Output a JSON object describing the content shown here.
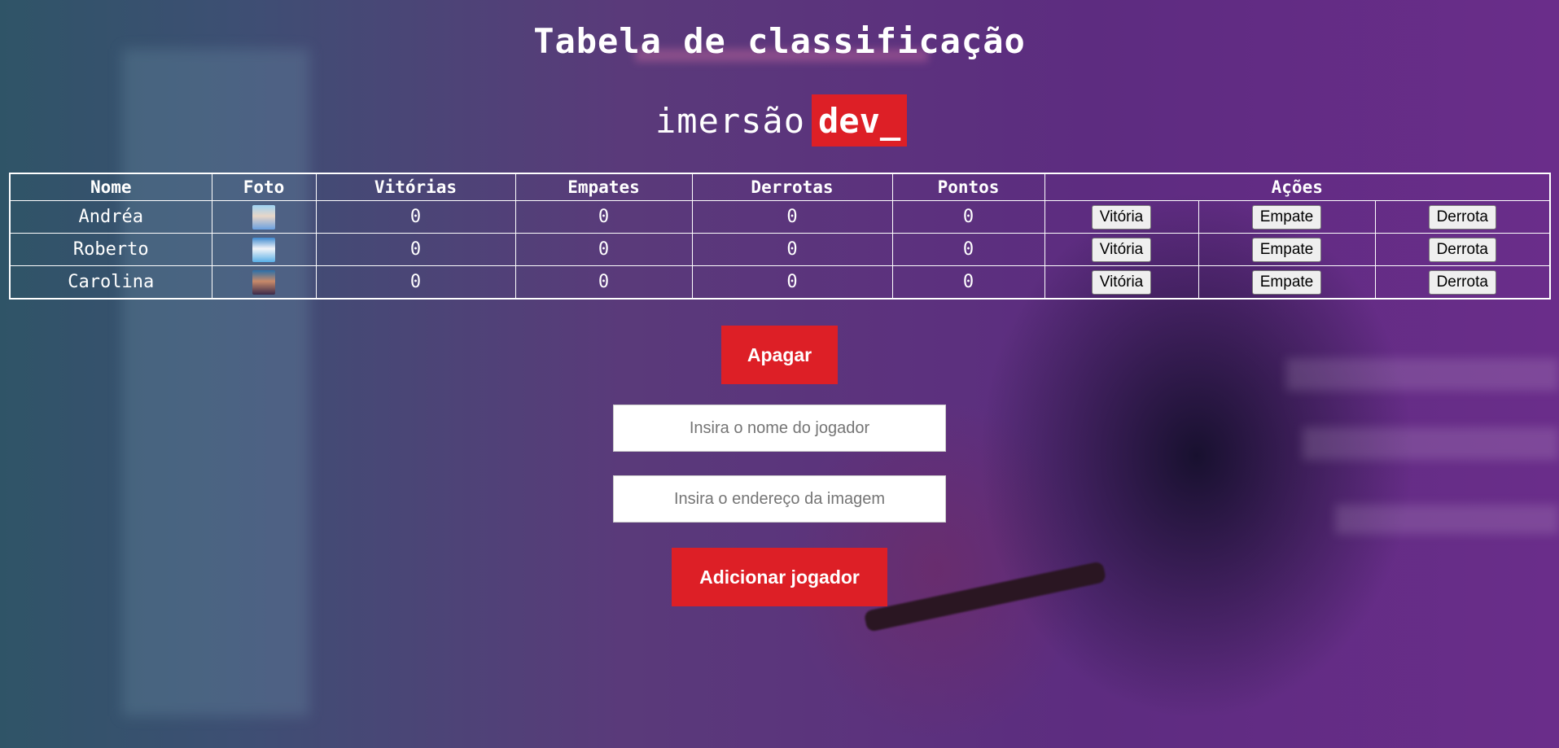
{
  "page": {
    "title": "Tabela de classificação",
    "brand": {
      "word": "imersão",
      "highlight": "dev_"
    },
    "colors": {
      "accent": "#dd1f26",
      "text": "#ffffff"
    }
  },
  "table": {
    "headers": {
      "name": "Nome",
      "photo": "Foto",
      "wins": "Vitórias",
      "draws": "Empates",
      "losses": "Derrotas",
      "points": "Pontos",
      "actions": "Ações"
    },
    "rows": [
      {
        "name": "Andréa",
        "photo": "elsa-avatar",
        "wins": "0",
        "draws": "0",
        "losses": "0",
        "points": "0"
      },
      {
        "name": "Roberto",
        "photo": "olaf-avatar",
        "wins": "0",
        "draws": "0",
        "losses": "0",
        "points": "0"
      },
      {
        "name": "Carolina",
        "photo": "anna-avatar",
        "wins": "0",
        "draws": "0",
        "losses": "0",
        "points": "0"
      }
    ],
    "actions": {
      "win": "Vitória",
      "draw": "Empate",
      "loss": "Derrota"
    }
  },
  "controls": {
    "clear_label": "Apagar",
    "name_placeholder": "Insira o nome do jogador",
    "image_placeholder": "Insira o endereço da imagem",
    "add_label": "Adicionar jogador"
  }
}
